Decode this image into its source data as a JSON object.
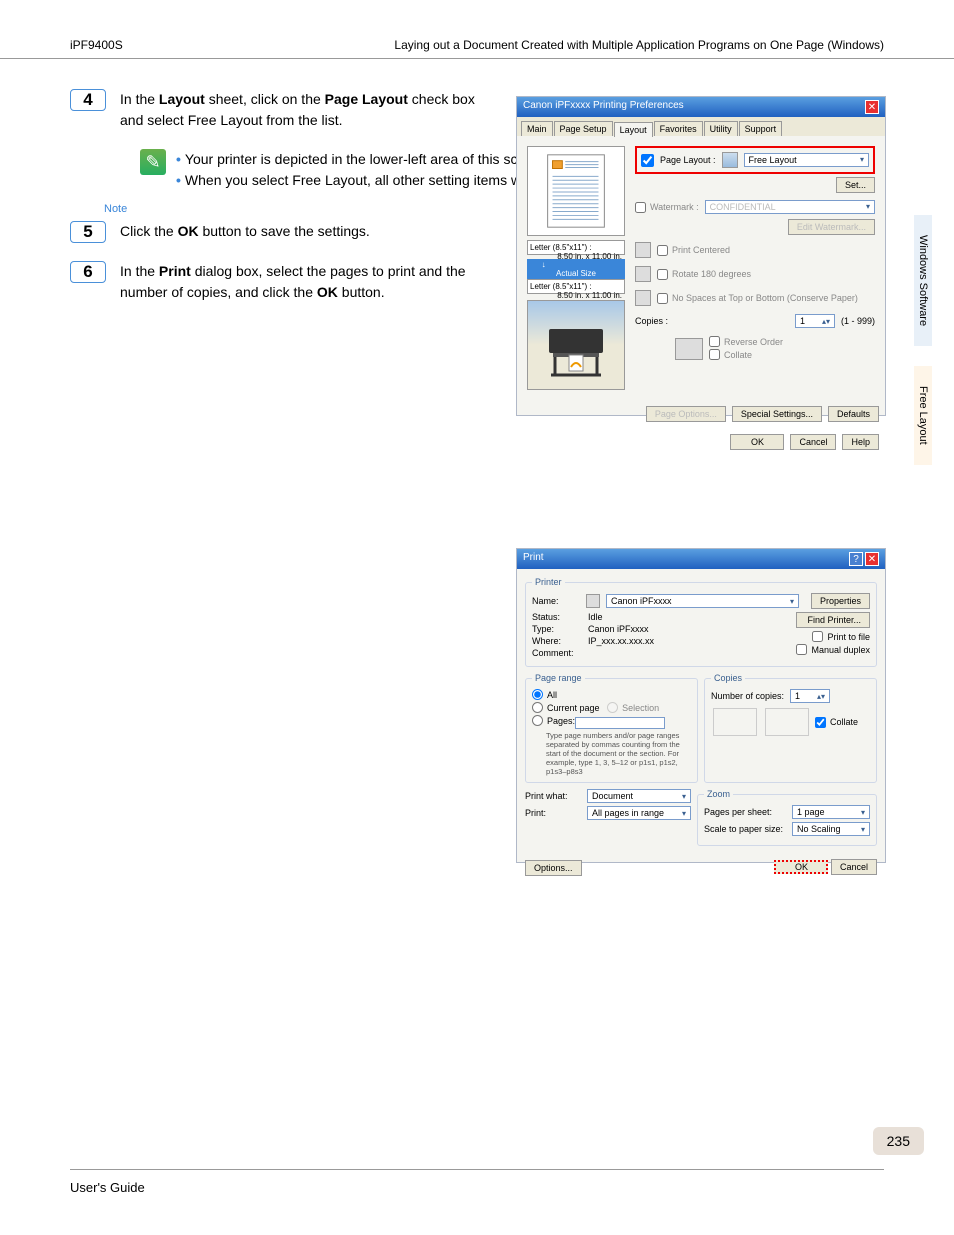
{
  "header": {
    "model": "iPF9400S",
    "pageTitle": "Laying out a Document Created with Multiple Application Programs on One Page (Windows)"
  },
  "steps": {
    "s4": {
      "num": "4",
      "textBefore": "In the ",
      "bold1": "Layout",
      "textMid": " sheet, click on the ",
      "bold2": "Page Layout",
      "textAfter": " check box and select Free Layout from the list."
    },
    "s5": {
      "num": "5",
      "textBefore": "Click the ",
      "bold1": "OK",
      "textAfter": " button to save the settings."
    },
    "s6": {
      "num": "6",
      "textBefore": "In the ",
      "bold1": "Print",
      "textMid": " dialog box, select the pages to print and the number of copies, and click the ",
      "bold2": "OK",
      "textAfter": " button."
    }
  },
  "note": {
    "label": "Note",
    "line1": "Your printer is depicted in the lower-left area of this screen.",
    "line2": "When you select Free Layout, all other setting items will be disabled."
  },
  "prefsDlg": {
    "title": "Canon iPFxxxx Printing Preferences",
    "tabs": [
      "Main",
      "Page Setup",
      "Layout",
      "Favorites",
      "Utility",
      "Support"
    ],
    "pageLayoutChk": "Page Layout :",
    "pageLayoutVal": "Free Layout",
    "setBtn": "Set...",
    "watermark": "Watermark :",
    "watermarkVal": "CONFIDENTIAL",
    "editWm": "Edit Watermark...",
    "printCentered": "Print Centered",
    "rotate180": "Rotate 180 degrees",
    "noSpaces": "No Spaces at Top or Bottom (Conserve Paper)",
    "copies": "Copies :",
    "copiesVal": "1",
    "copiesRange": "(1 - 999)",
    "reverseOrder": "Reverse Order",
    "collate": "Collate",
    "pageOptions": "Page Options...",
    "specialSettings": "Special Settings...",
    "defaults": "Defaults",
    "ok": "OK",
    "cancel": "Cancel",
    "help": "Help",
    "paper1a": "Letter (8.5\"x11\") :",
    "paper1b": "8.50 in. x 11.00 in.",
    "actualSize": "↓  Actual Size",
    "paper2a": "Letter (8.5\"x11\") :",
    "paper2b": "8.50 in. x 11.00 in."
  },
  "printDlg": {
    "title": "Print",
    "printer": "Printer",
    "name": "Name:",
    "nameVal": "Canon iPFxxxx",
    "properties": "Properties",
    "status": "Status:",
    "statusVal": "Idle",
    "type": "Type:",
    "typeVal": "Canon iPFxxxx",
    "where": "Where:",
    "whereVal": "IP_xxx.xx.xxx.xx",
    "comment": "Comment:",
    "findPrinter": "Find Printer...",
    "printToFile": "Print to file",
    "manualDuplex": "Manual duplex",
    "pageRange": "Page range",
    "all": "All",
    "currentPage": "Current page",
    "selection": "Selection",
    "pages": "Pages:",
    "hint": "Type page numbers and/or page ranges separated by commas counting from the start of the document or the section. For example, type 1, 3, 5–12 or p1s1, p1s2, p1s3–p8s3",
    "copies": "Copies",
    "numCopies": "Number of copies:",
    "numCopiesVal": "1",
    "collate": "Collate",
    "printWhat": "Print what:",
    "printWhatVal": "Document",
    "printLbl": "Print:",
    "printVal": "All pages in range",
    "zoom": "Zoom",
    "pagesPerSheet": "Pages per sheet:",
    "pagesPerSheetVal": "1 page",
    "scaleToSize": "Scale to paper size:",
    "scaleToSizeVal": "No Scaling",
    "options": "Options...",
    "ok": "OK",
    "cancel": "Cancel"
  },
  "sidebar": {
    "tab1": "Windows Software",
    "tab2": "Free Layout"
  },
  "footer": {
    "guide": "User's Guide",
    "pageNum": "235"
  }
}
